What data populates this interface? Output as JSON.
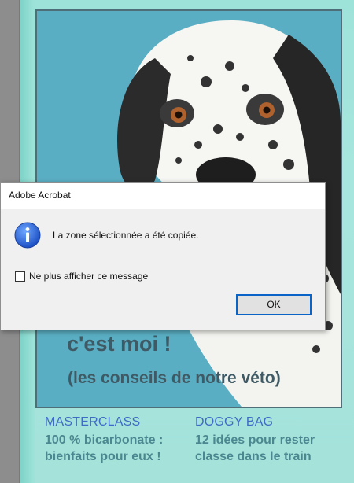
{
  "document": {
    "hero": {
      "line1": "c'est moi !",
      "line2": "(les conseils de notre véto)"
    },
    "teasers": [
      {
        "title": "MASTERCLASS",
        "body_line1": "100 % bicarbonate :",
        "body_line2": "bienfaits pour eux !"
      },
      {
        "title": "DOGGY BAG",
        "body_line1": "12 idées pour rester",
        "body_line2": "classe dans le train"
      }
    ]
  },
  "dialog": {
    "title": "Adobe Acrobat",
    "message": "La zone sélectionnée a été copiée.",
    "checkbox_label": "Ne plus afficher ce message",
    "checkbox_checked": false,
    "ok_label": "OK",
    "icon": "info-icon"
  },
  "colors": {
    "hero_background": "#5aaec3",
    "page_background": "#9ee3da",
    "teaser_title": "#3d6bc6",
    "dialog_accent": "#0a64c8"
  }
}
